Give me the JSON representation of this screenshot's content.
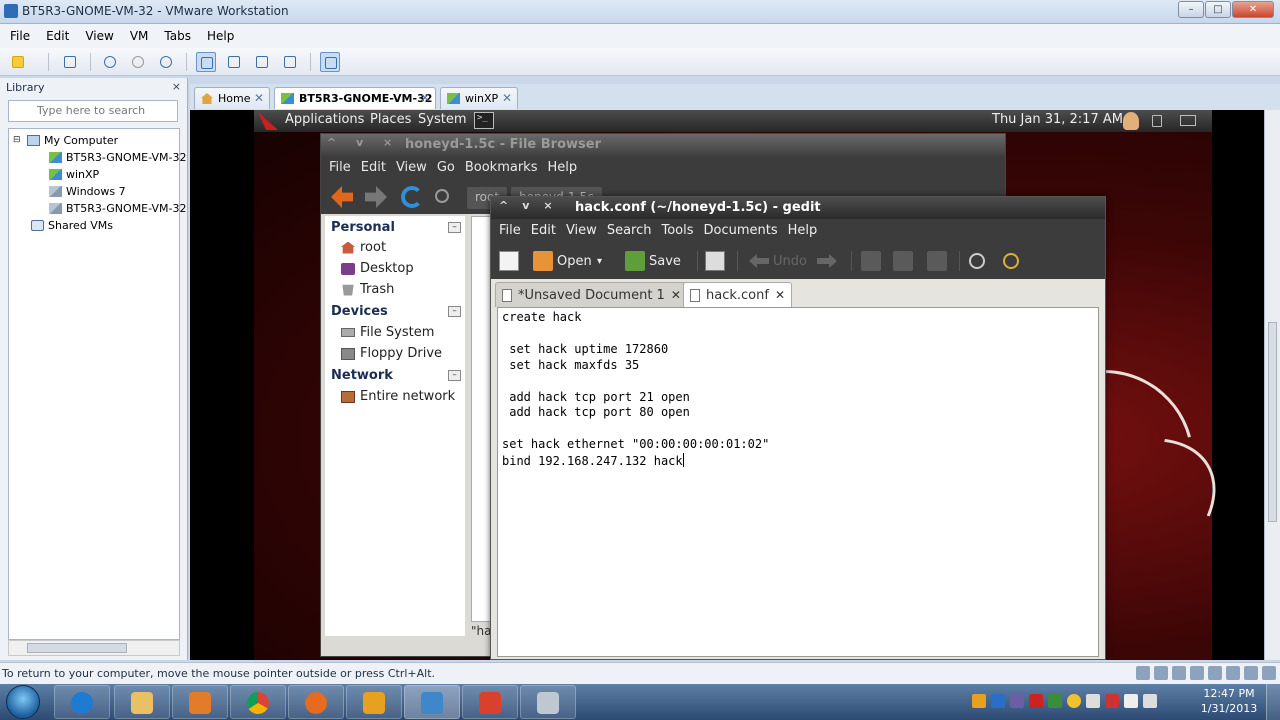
{
  "vmware": {
    "title": "BT5R3-GNOME-VM-32 - VMware Workstation",
    "window_controls": {
      "minimize": "–",
      "maximize": "□",
      "close": "✕"
    },
    "menu": [
      "File",
      "Edit",
      "View",
      "VM",
      "Tabs",
      "Help"
    ],
    "library": {
      "header": "Library",
      "close": "×",
      "search_placeholder": "Type here to search",
      "tree": [
        {
          "label": "My Computer",
          "level": 0,
          "icon": "computer-icon"
        },
        {
          "label": "BT5R3-GNOME-VM-32",
          "level": 1,
          "icon": "vm-running-icon"
        },
        {
          "label": "winXP",
          "level": 1,
          "icon": "vm-running-icon"
        },
        {
          "label": "Windows 7",
          "level": 1,
          "icon": "vm-icon"
        },
        {
          "label": "BT5R3-GNOME-VM-32",
          "level": 1,
          "icon": "vm-icon"
        },
        {
          "label": "Shared VMs",
          "level": 0,
          "icon": "shared-vms-icon"
        }
      ]
    },
    "tabs": [
      {
        "label": "Home",
        "icon": "home-icon",
        "active": false
      },
      {
        "label": "BT5R3-GNOME-VM-32",
        "icon": "vm-running-icon",
        "active": true
      },
      {
        "label": "winXP",
        "icon": "vm-running-icon",
        "active": false
      }
    ],
    "tab_close": "✕",
    "status_message": "To return to your computer, move the mouse pointer outside or press Ctrl+Alt."
  },
  "gnome_panel": {
    "menus": [
      "Applications",
      "Places",
      "System"
    ],
    "clock": "Thu Jan 31,  2:17 AM"
  },
  "file_browser": {
    "title": "honeyd-1.5c - File Browser",
    "controls": "^ v ×",
    "menu": [
      "File",
      "Edit",
      "View",
      "Go",
      "Bookmarks",
      "Help"
    ],
    "breadcrumbs": [
      "root",
      "honeyd-1.5c"
    ],
    "sidebar": {
      "personal": {
        "header": "Personal",
        "items": [
          "root",
          "Desktop",
          "Trash"
        ]
      },
      "devices": {
        "header": "Devices",
        "items": [
          "File System",
          "Floppy Drive"
        ]
      },
      "network": {
        "header": "Network",
        "items": [
          "Entire network"
        ]
      }
    },
    "collapse_symbol": "–",
    "status": "\"ha"
  },
  "gedit": {
    "title": "hack.conf (~/honeyd-1.5c) - gedit",
    "controls": [
      "^",
      "v",
      "×"
    ],
    "menu": [
      "File",
      "Edit",
      "View",
      "Search",
      "Tools",
      "Documents",
      "Help"
    ],
    "toolbar": {
      "open_label": "Open",
      "save_label": "Save",
      "undo_label": "Undo",
      "dropdown": "▾"
    },
    "tabs": [
      {
        "label": "*Unsaved Document 1",
        "active": false
      },
      {
        "label": "hack.conf",
        "active": true
      }
    ],
    "tab_close": "✕",
    "content": "create hack\n\n set hack uptime 172860\n set hack maxfds 35\n\n add hack tcp port 21 open\n add hack tcp port 80 open\n\nset hack ethernet \"00:00:00:00:01:02\"\nbind 192.168.247.132 hack"
  },
  "taskbar": {
    "time": "12:47 PM",
    "date": "1/31/2013"
  }
}
